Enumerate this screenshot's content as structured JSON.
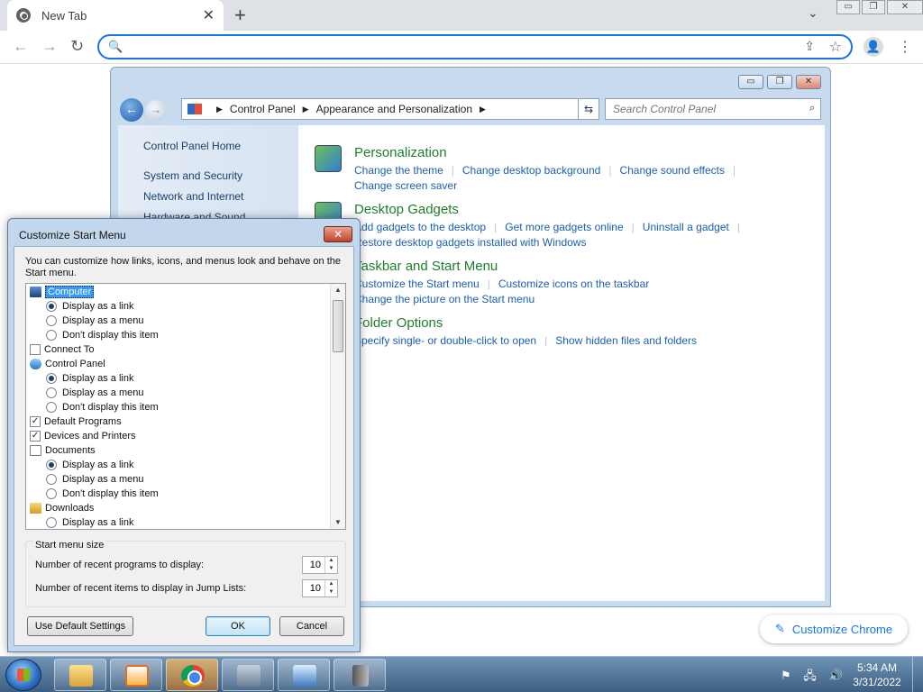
{
  "browser": {
    "tab_title": "New Tab",
    "tab_close": "✕",
    "new_tab": "+",
    "tab_search": "⌄",
    "window_controls": [
      "▭",
      "❐",
      "✕"
    ],
    "back": "←",
    "forward": "→",
    "reload": "↻",
    "omnibox_value": "",
    "search_icon": "🔍",
    "share_icon": "⇪",
    "star_icon": "☆",
    "profile_icon": "👤",
    "menu_icon": "⋮",
    "customize_chrome": "Customize Chrome",
    "pen_icon": "✎"
  },
  "control_panel": {
    "window_controls": [
      "▭",
      "❐",
      "✕"
    ],
    "back": "←",
    "forward": "→",
    "breadcrumb": [
      "Control Panel",
      "Appearance and Personalization"
    ],
    "breadcrumb_sep": "▶",
    "address_drop": "▼",
    "refresh_icon": "⇆",
    "search_placeholder": "Search Control Panel",
    "search_icon": "⌕",
    "sidebar": [
      "Control Panel Home",
      "System and Security",
      "Network and Internet",
      "Hardware and Sound"
    ],
    "categories": [
      {
        "title": "Personalization",
        "links": [
          "Change the theme",
          "Change desktop background",
          "Change sound effects",
          "Change screen saver"
        ]
      },
      {
        "title": "Desktop Gadgets",
        "links": [
          "Add gadgets to the desktop",
          "Get more gadgets online",
          "Uninstall a gadget",
          "Restore desktop gadgets installed with Windows"
        ]
      },
      {
        "title": "Taskbar and Start Menu",
        "links": [
          "Customize the Start menu",
          "Customize icons on the taskbar",
          "Change the picture on the Start menu"
        ]
      },
      {
        "title": "Folder Options",
        "links": [
          "Specify single- or double-click to open",
          "Show hidden files and folders"
        ]
      }
    ]
  },
  "dialog": {
    "title": "Customize Start Menu",
    "close": "✕",
    "description": "You can customize how links, icons, and menus look and behave on the Start menu.",
    "tree": [
      {
        "kind": "header",
        "icon": "computer",
        "label": "Computer",
        "selected": true
      },
      {
        "kind": "radio",
        "label": "Display as a link",
        "checked": true
      },
      {
        "kind": "radio",
        "label": "Display as a menu",
        "checked": false
      },
      {
        "kind": "radio",
        "label": "Don't display this item",
        "checked": false
      },
      {
        "kind": "check",
        "label": "Connect To",
        "checked": false
      },
      {
        "kind": "header",
        "icon": "control-panel",
        "label": "Control Panel"
      },
      {
        "kind": "radio",
        "label": "Display as a link",
        "checked": true
      },
      {
        "kind": "radio",
        "label": "Display as a menu",
        "checked": false
      },
      {
        "kind": "radio",
        "label": "Don't display this item",
        "checked": false
      },
      {
        "kind": "check",
        "label": "Default Programs",
        "checked": true
      },
      {
        "kind": "check",
        "label": "Devices and Printers",
        "checked": true
      },
      {
        "kind": "header",
        "icon": "documents",
        "label": "Documents"
      },
      {
        "kind": "radio",
        "label": "Display as a link",
        "checked": true
      },
      {
        "kind": "radio",
        "label": "Display as a menu",
        "checked": false
      },
      {
        "kind": "radio",
        "label": "Don't display this item",
        "checked": false
      },
      {
        "kind": "header",
        "icon": "downloads",
        "label": "Downloads"
      },
      {
        "kind": "radio",
        "label": "Display as a link",
        "checked": false
      }
    ],
    "scroll_up": "▲",
    "scroll_down": "▼",
    "size_group": {
      "legend": "Start menu size",
      "recent_programs_label": "Number of recent programs to display:",
      "recent_programs_value": "10",
      "jump_list_label": "Number of recent items to display in Jump Lists:",
      "jump_list_value": "10",
      "spin_up": "▲",
      "spin_down": "▼"
    },
    "use_default": "Use Default Settings",
    "ok": "OK",
    "cancel": "Cancel"
  },
  "taskbar": {
    "items": [
      "explorer",
      "media-player",
      "chrome",
      "network",
      "control-panel",
      "server-manager"
    ],
    "tray_icons": [
      "⚑",
      "🖧",
      "🔊"
    ],
    "time": "5:34 AM",
    "date": "3/31/2022"
  }
}
